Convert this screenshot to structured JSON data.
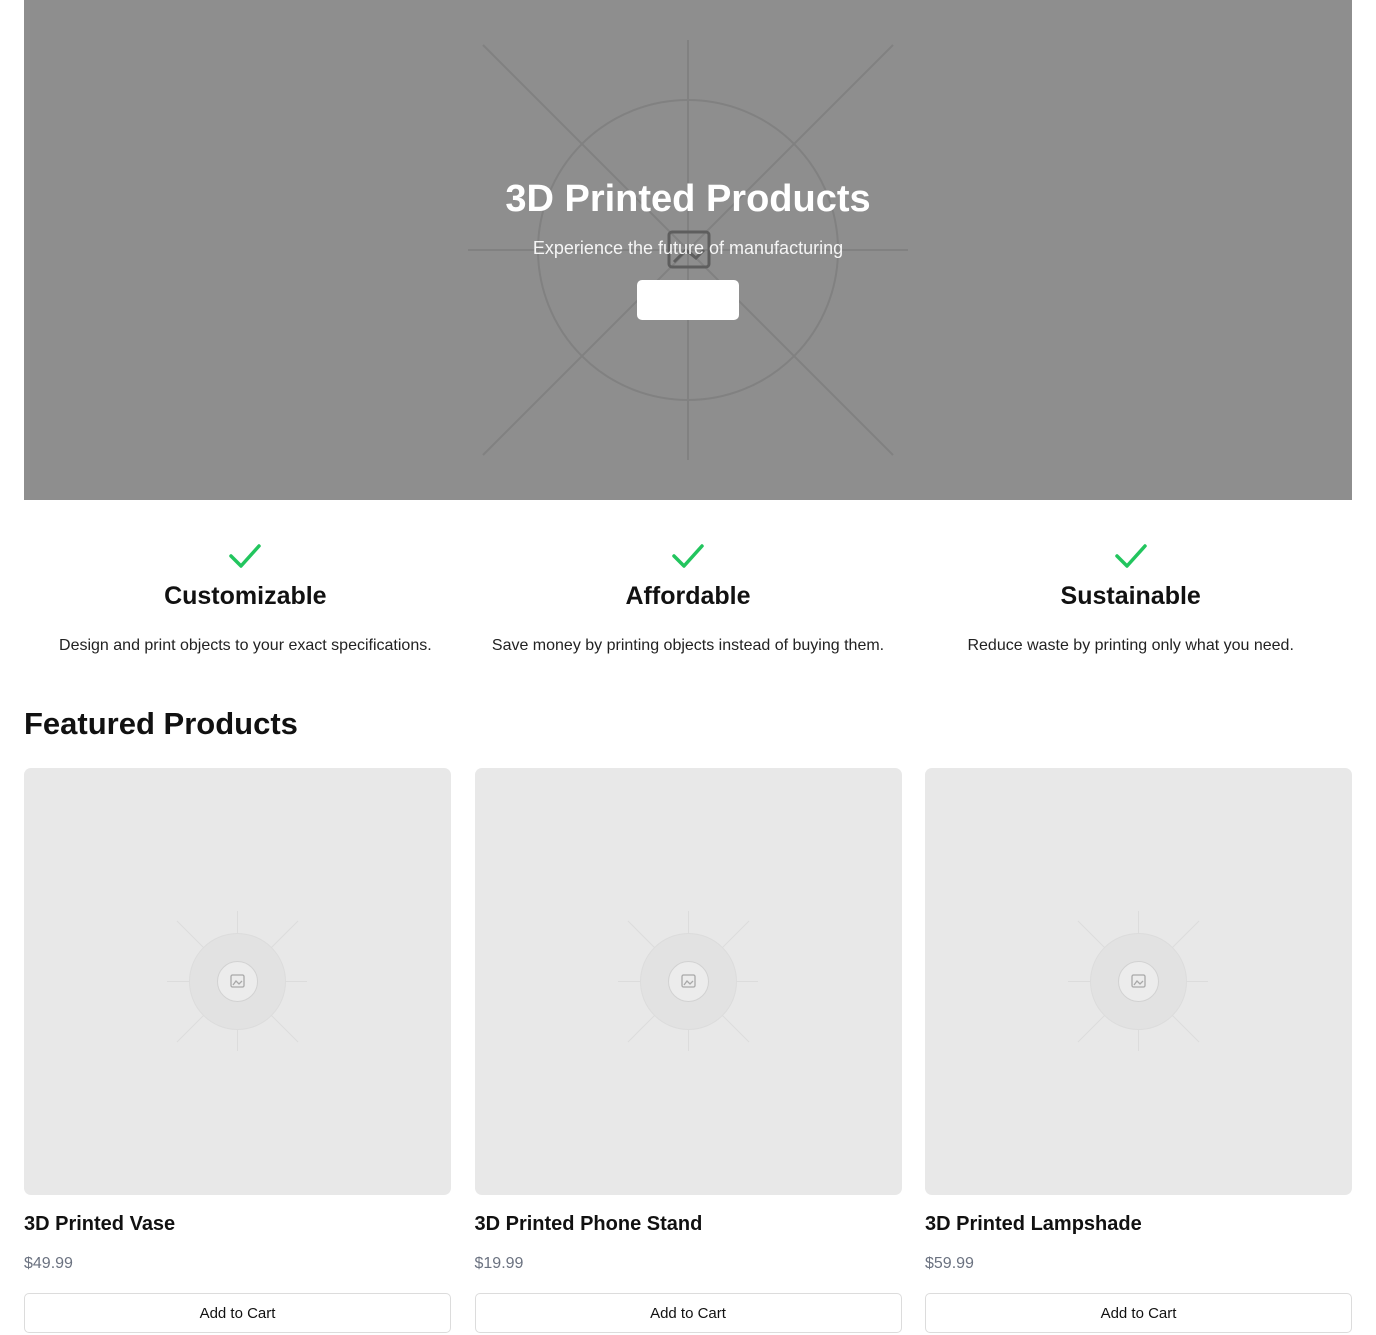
{
  "hero": {
    "title": "3D Printed Products",
    "subtitle": "Experience the future of manufacturing",
    "button_label": "",
    "background_color": "#8e8e8e",
    "image_icon": "image-placeholder-icon"
  },
  "features": [
    {
      "icon": "check-icon",
      "title": "Customizable",
      "description": "Design and print objects to your exact specifications."
    },
    {
      "icon": "check-icon",
      "title": "Affordable",
      "description": "Save money by printing objects instead of buying them."
    },
    {
      "icon": "check-icon",
      "title": "Sustainable",
      "description": "Reduce waste by printing only what you need."
    }
  ],
  "colors": {
    "check": "#22c55e",
    "price": "#6b7280",
    "card_image_bg": "#e8e8e8"
  },
  "featured": {
    "title": "Featured Products",
    "products": [
      {
        "name": "3D Printed Vase",
        "price": "$49.99",
        "button_label": "Add to Cart",
        "image_icon": "image-placeholder-icon"
      },
      {
        "name": "3D Printed Phone Stand",
        "price": "$19.99",
        "button_label": "Add to Cart",
        "image_icon": "image-placeholder-icon"
      },
      {
        "name": "3D Printed Lampshade",
        "price": "$59.99",
        "button_label": "Add to Cart",
        "image_icon": "image-placeholder-icon"
      }
    ]
  }
}
